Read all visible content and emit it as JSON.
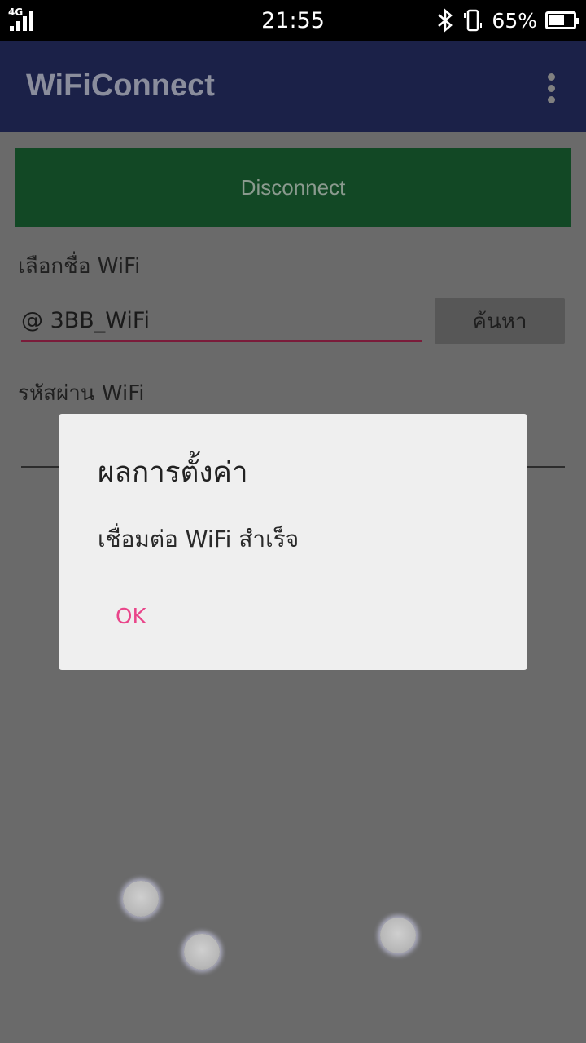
{
  "status_bar": {
    "network_type": "4G",
    "time": "21:55",
    "battery_percent": "65%",
    "battery_level": 0.65,
    "icons": [
      "signal-icon",
      "bluetooth-icon",
      "vibrate-icon",
      "battery-icon"
    ]
  },
  "app_bar": {
    "title": "WiFiConnect",
    "menu_icon": "overflow-menu-icon"
  },
  "main": {
    "disconnect_label": "Disconnect",
    "ssid_label": "เลือกชื่อ WiFi",
    "ssid_value": "@ 3BB_WiFi",
    "search_label": "ค้นหา",
    "password_label": "รหัสผ่าน WiFi",
    "password_value": ""
  },
  "dialog": {
    "title": "ผลการตั้งค่า",
    "message": "เชื่อมต่อ WiFi สำเร็จ",
    "ok_label": "OK"
  },
  "colors": {
    "app_bar": "#1b2148",
    "disconnect_button": "#124825",
    "accent": "#e9458a",
    "scrim": "#6a6a6a"
  }
}
